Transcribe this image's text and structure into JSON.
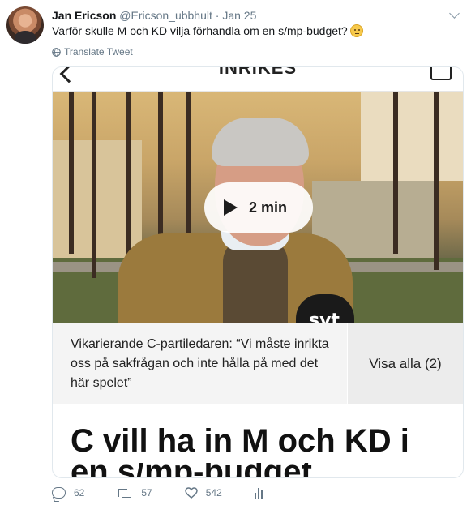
{
  "tweet": {
    "author_name": "Jan Ericson",
    "author_handle": "@Ericson_ubbhult",
    "separator": "·",
    "date": "Jan 25",
    "text": "Varför skulle M och KD vilja förhandla om en s/mp-budget?",
    "emoji_icon": "face-with-rolling-eyes-emoji",
    "translate_label": "Translate Tweet"
  },
  "card": {
    "section_label": "INRIKES",
    "video": {
      "duration": "2 min",
      "mic_logo": "svt"
    },
    "caption": "Vikarierande C-partiledaren: “Vi måste inrikta oss på sakfrågan och inte hålla på med det här spelet”",
    "show_all_label": "Visa alla (2)",
    "headline": "C vill ha in M och KD i",
    "headline_cutoff": "en s/mp-budget"
  },
  "actions": {
    "replies": "62",
    "retweets": "57",
    "likes": "542"
  },
  "colors": {
    "secondary_text": "#657786",
    "border": "#e1e8ed",
    "caption_bg": "#f4f4f4"
  }
}
